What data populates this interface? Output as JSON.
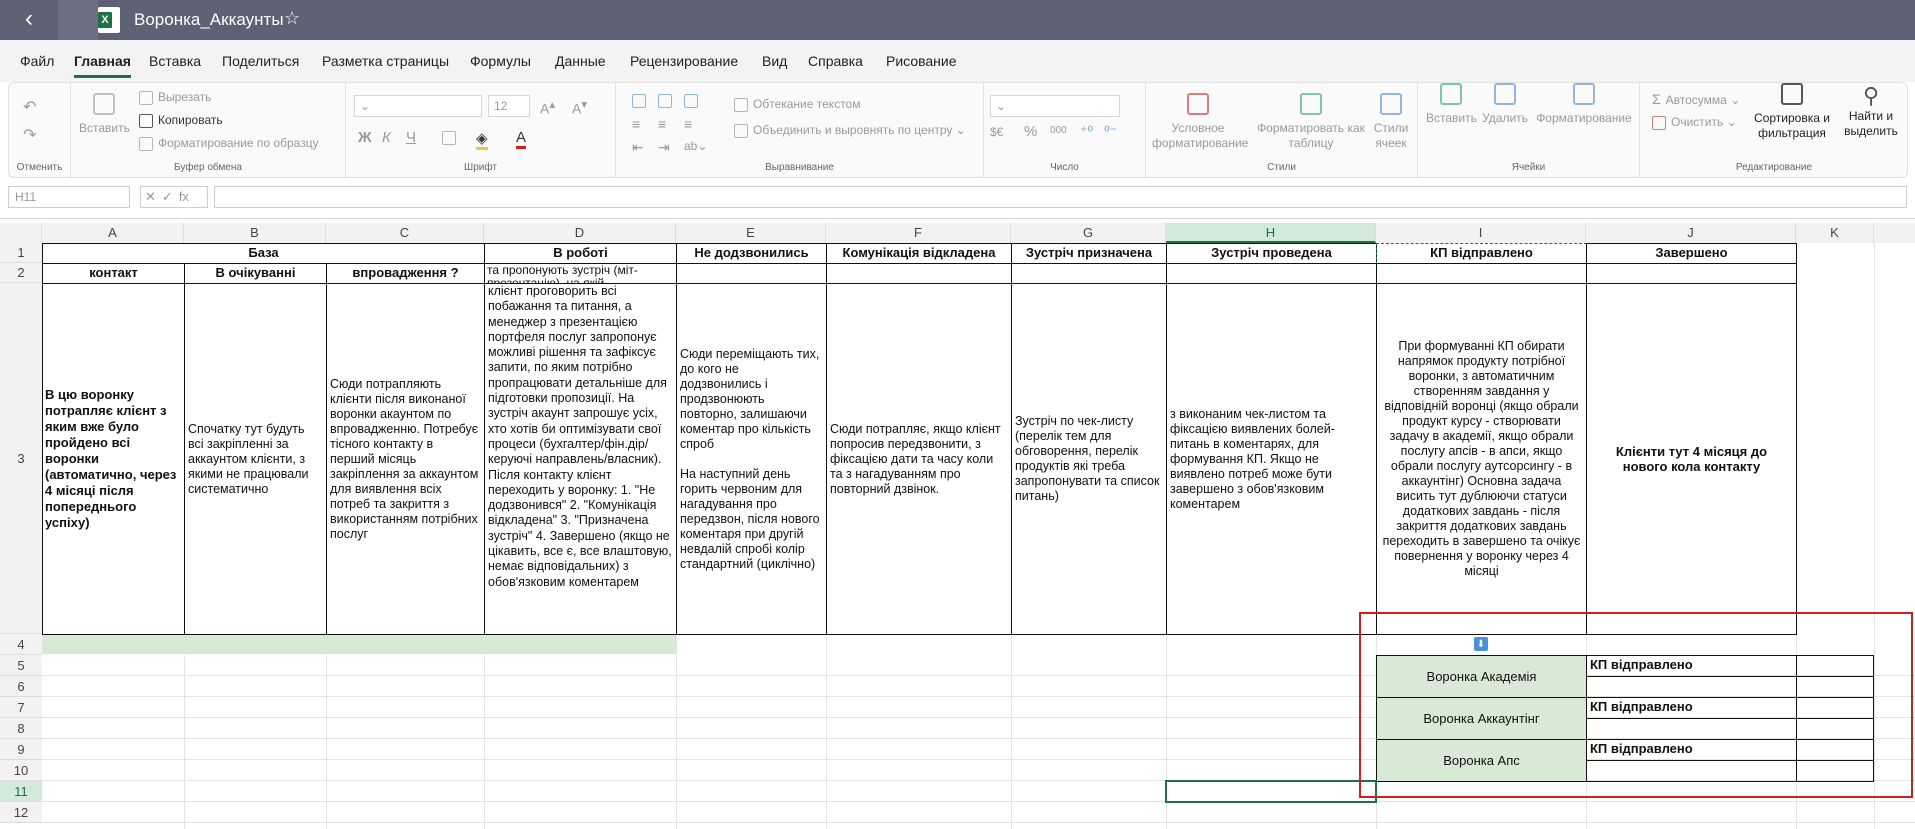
{
  "titlebar": {
    "file_name": "Воронка_Аккаунты",
    "back_icon": "back-arrow-icon",
    "star_icon": "star-icon",
    "app_icon": "excel-icon"
  },
  "menu": {
    "tabs": [
      "Файл",
      "Главная",
      "Вставка",
      "Поделиться",
      "Разметка страницы",
      "Формулы",
      "Данные",
      "Рецензирование",
      "Вид",
      "Справка",
      "Рисование"
    ],
    "active_index": 1
  },
  "ribbon": {
    "undo": {
      "label": "Отменить"
    },
    "clipboard": {
      "paste": "Вставить",
      "cut": "Вырезать",
      "copy": "Копировать",
      "format_painter": "Форматирование по образцу",
      "label": "Буфер обмена"
    },
    "font": {
      "size": "12",
      "bold": "Ж",
      "italic": "К",
      "underline": "Ч",
      "label": "Шрифт"
    },
    "alignment": {
      "wrap": "Обтекание текстом",
      "merge": "Объединить и выровнять по центру",
      "label": "Выравнивание"
    },
    "number": {
      "currency": "$€",
      "percent": "%",
      "thousands": "000",
      "label": "Число"
    },
    "styles": {
      "conditional": "Условное форматирование",
      "format_table": "Форматировать как таблицу",
      "cell_styles": "Стили ячеек",
      "label": "Стили"
    },
    "cells": {
      "insert": "Вставить",
      "delete": "Удалить",
      "format": "Форматирование",
      "label": "Ячейки"
    },
    "editing": {
      "autosum": "Автосумма",
      "clear": "Очистить",
      "sort": "Сортировка и фильтрация",
      "find": "Найти и выделить",
      "label": "Редактирование"
    }
  },
  "formula_bar": {
    "name_box": "H11",
    "fx": "fx",
    "cancel": "✕",
    "enter": "✓",
    "value": ""
  },
  "sheet": {
    "columns": [
      "A",
      "B",
      "C",
      "D",
      "E",
      "F",
      "G",
      "H",
      "I",
      "J",
      "K"
    ],
    "rows": [
      "1",
      "2",
      "3",
      "4",
      "5",
      "6",
      "7",
      "8",
      "9",
      "10",
      "11",
      "12"
    ],
    "selected_column": "H",
    "selected_row": "11",
    "selected_cell": "H11",
    "row1": {
      "A_B_C": "База",
      "D": "В роботі",
      "E": "Не додзвонились",
      "F": "Комунікація відкладена",
      "G": "Зустріч призначена",
      "H": "Зустріч проведена",
      "I": "КП відправлено",
      "J": "Завершено"
    },
    "row2": {
      "A": "контакт",
      "B": "В очікуванні",
      "C": "впровадження ?",
      "D_partial": "та пропонують зустріч (міт-презентацію), на якій"
    },
    "row3": {
      "A": "В цю воронку потрапляє клієнт з яким вже було пройдено всі воронки (автоматично, через 4 місяці після попереднього успіху)",
      "B": "Спочатку тут будуть всі закріпленні за аккаунтом клієнти, з якими не працювали систематично",
      "C": "Сюди потрапляють клієнти після виконаної воронки акаунтом по впровадженню. Потребує тісного контакту в перший місяць закріплення за аккаунтом для виявлення всіх потреб та закриття з використанням потрібних послуг",
      "D": "клієнт проговорить всі побажання та питання, а менеджер з презентацією портфеля послуг запропонує можливі рішення та зафіксує запити, по яким потрібно пропрацювати детальніше для підготовки пропозиції. На зустріч акаунт запрошує усіх, хто хотів би оптимізувати свої процеси (бухгалтер/фін.дір/керуючі направлень/власник). Після контакту клієнт переходить у воронку: 1. \"Не додзвонився\" 2. \"Комунікація відкладена\" 3. \"Призначена зустріч\" 4. Завершено (якщо не цікавить, все є, все влаштовую, немає відповідальних) з обов'язковим коментарем",
      "E_1": "Сюди переміщають тих, до кого не додзвонились і продзвонюють повторно, залишаючи коментар про кількість спроб",
      "E_2": "На наступний день горить червоним для нагадування про передзвон, після нового коментаря при другій невдалій спробі колір стандартний (циклічно)",
      "F": "Сюди потрапляє, якщо клієнт попросив передзвонити, з фіксацією дати та часу коли та з нагадуванням про повторний дзвінок.",
      "G": "Зустріч по чек-листу (перелік тем для обговорення, перелік продуктів які треба запропонувати та список питань)",
      "H": "з виконаним чек-листом та фіксацією виявлених болей-питань в коментарях, для формування КП. Якщо не виявлено потреб може бути завершено з обов'язковим коментарем",
      "I": "При формуванні КП обирати напрямок продукту потрібної воронки, з автоматичним створенням завдання у відповідній воронці (якщо обрали продукт курсу - створювати задачу в академії, якщо обрали послугу апсів - в апси, якщо обрали послугу аутсорсингу - в аккаунтінг) Основна задача висить тут дублюючи статуси додаткових завдань - після закриття додаткових завдань переходить в завершено та очікує повернення у воронку через 4 місяці",
      "J": "Клієнти тут 4 місяця до нового кола контакту"
    },
    "funnels": [
      {
        "name": "Воронка Академія",
        "status": "КП відправлено"
      },
      {
        "name": "Воронка Аккаунтінг",
        "status": "КП відправлено"
      },
      {
        "name": "Воронка Апс",
        "status": "КП відправлено"
      }
    ],
    "marker_icon": "down-arrow-icon"
  },
  "colors": {
    "titlebar": "#5f6274",
    "accent": "#1e7145",
    "highlight": "#d8ead5",
    "annotation": "#cc1f1f"
  }
}
